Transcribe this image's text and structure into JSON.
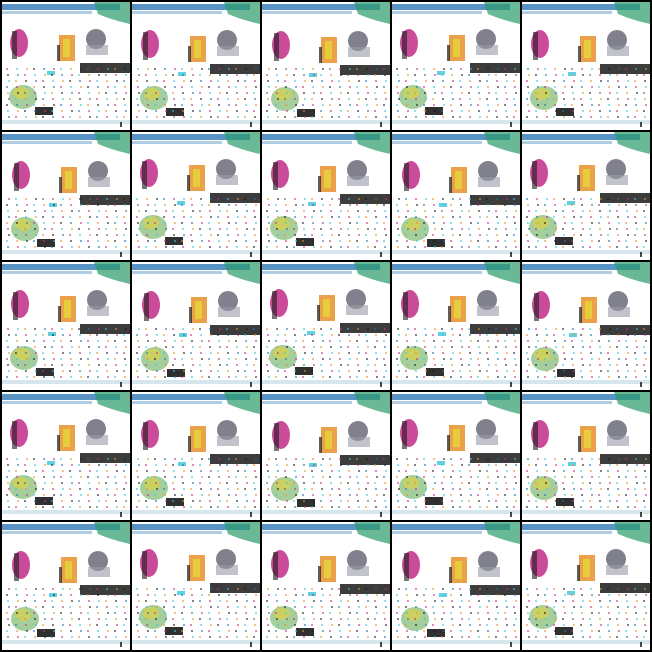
{
  "grid": {
    "rows": 5,
    "columns": 5,
    "tile_count": 25
  },
  "colors": {
    "background": "#ffffff",
    "border": "#000000",
    "top_band": "#1f6fb2",
    "corner_teal": "#2a9a6a",
    "magenta": "#c22b8a",
    "orange": "#e8902a",
    "yellow": "#e6d23a",
    "dark": "#1a1a1a",
    "cyan": "#3ac6d8",
    "green": "#5aa84a"
  },
  "tiles": [
    {
      "id": 1
    },
    {
      "id": 2
    },
    {
      "id": 3
    },
    {
      "id": 4
    },
    {
      "id": 5
    },
    {
      "id": 6
    },
    {
      "id": 7
    },
    {
      "id": 8
    },
    {
      "id": 9
    },
    {
      "id": 10
    },
    {
      "id": 11
    },
    {
      "id": 12
    },
    {
      "id": 13
    },
    {
      "id": 14
    },
    {
      "id": 15
    },
    {
      "id": 16
    },
    {
      "id": 17
    },
    {
      "id": 18
    },
    {
      "id": 19
    },
    {
      "id": 20
    },
    {
      "id": 21
    },
    {
      "id": 22
    },
    {
      "id": 23
    },
    {
      "id": 24
    },
    {
      "id": 25
    }
  ]
}
